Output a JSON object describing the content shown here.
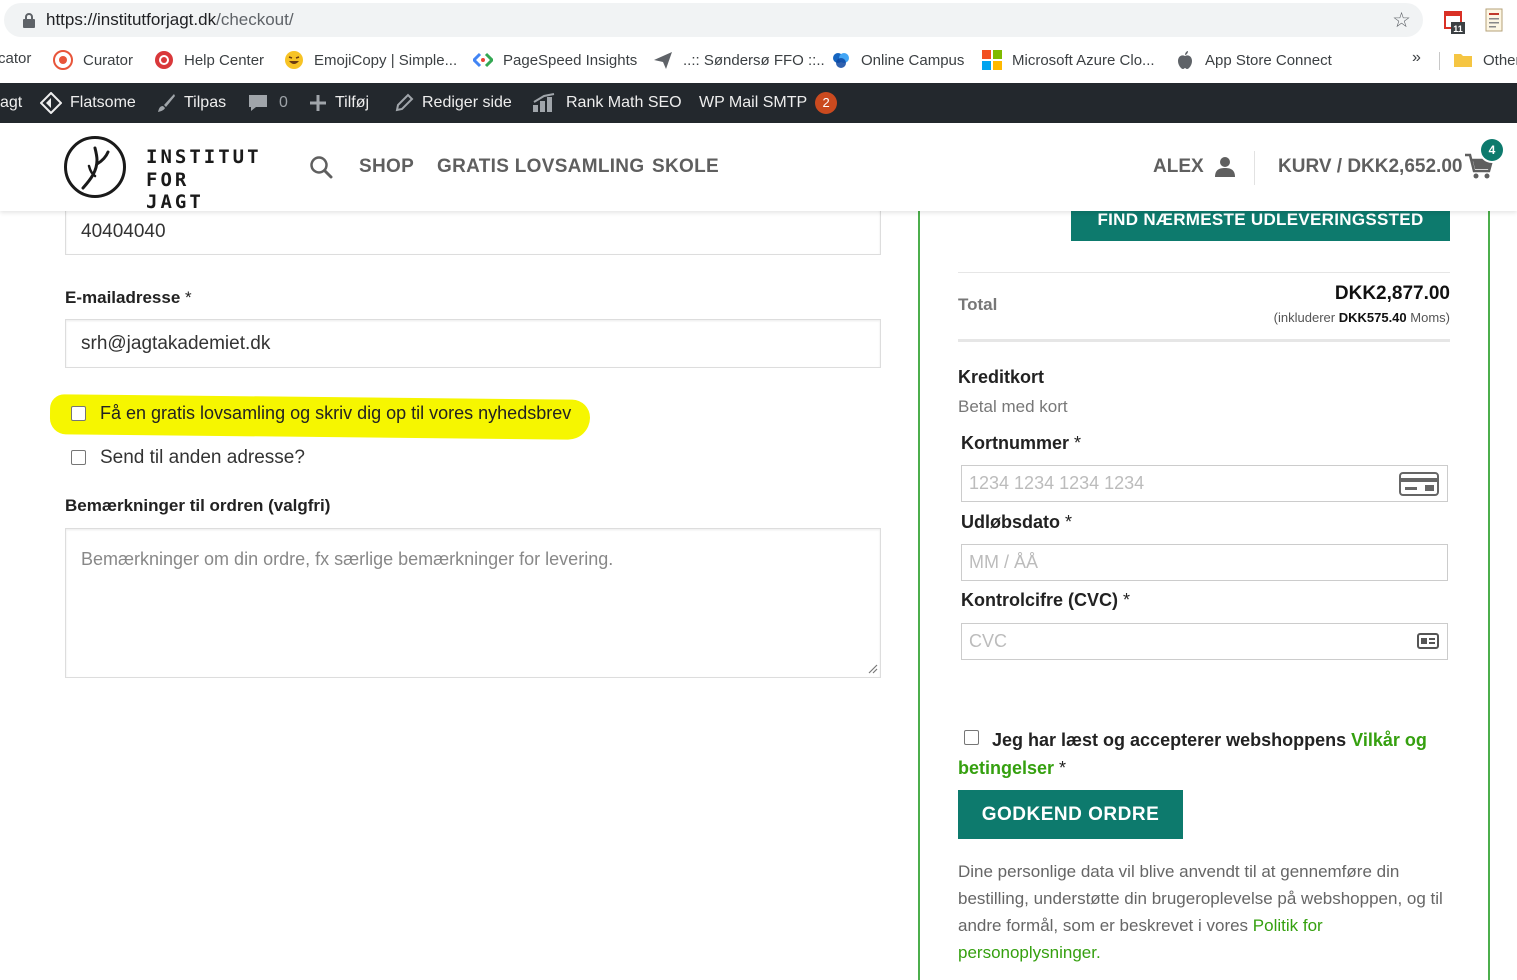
{
  "browser": {
    "url_host": "https://institutforjagt.dk",
    "url_path": "/checkout/",
    "calendar_badge": "11",
    "bookmarks": [
      {
        "label": "cator",
        "icon": "bookmark-icon"
      },
      {
        "label": "Curator",
        "icon": "curator-icon"
      },
      {
        "label": "Help Center",
        "icon": "help-center-icon"
      },
      {
        "label": "EmojiCopy | Simple...",
        "icon": "emoji-icon"
      },
      {
        "label": "PageSpeed Insights",
        "icon": "pagespeed-icon"
      },
      {
        "label": "..:: Søndersø FFO ::..",
        "icon": "paper-plane-icon"
      },
      {
        "label": "Online Campus",
        "icon": "online-campus-icon"
      },
      {
        "label": "Microsoft Azure Clo...",
        "icon": "microsoft-icon"
      },
      {
        "label": "App Store Connect",
        "icon": "apple-icon"
      }
    ],
    "bookmarks_more": "»",
    "other_bookmarks": "Other"
  },
  "adminbar": {
    "site": "agt",
    "flatsome": "Flatsome",
    "customize": "Tilpas",
    "comments_count": "0",
    "new": "Tilføj",
    "edit_page": "Rediger side",
    "rank_math": "Rank Math SEO",
    "wp_mail_smtp": "WP Mail SMTP",
    "smtp_badge": "2"
  },
  "header": {
    "logo_line1": "INSTITUT",
    "logo_line2": "FOR JAGT",
    "nav": [
      "SHOP",
      "GRATIS LOVSAMLING",
      "SKOLE"
    ],
    "account": "ALEX",
    "cart": "KURV / DKK2,652.00",
    "cart_count": "4"
  },
  "form": {
    "phone_value": "40404040",
    "email_label": "E-mailadresse",
    "required_mark": "*",
    "email_value": "srh@jagtakademiet.dk",
    "newsletter_label": "Få en gratis lovsamling og skriv dig op til vores nyhedsbrev",
    "ship_different_label": "Send til anden adresse?",
    "notes_label": "Bemærkninger til ordren (valgfri)",
    "notes_placeholder": "Bemærkninger om din ordre, fx særlige bemærkninger for levering."
  },
  "order": {
    "find_pickup_button": "FIND NÆRMESTE UDLEVERINGSSTED",
    "total_label": "Total",
    "total_value": "DKK2,877.00",
    "tax_prefix": "(inkluderer",
    "tax_amount": "DKK575.40",
    "tax_suffix": "Moms)",
    "payment_method_title": "Kreditkort",
    "payment_method_desc": "Betal med kort",
    "card_number_label": "Kortnummer",
    "card_number_placeholder": "1234 1234 1234 1234",
    "expiry_label": "Udløbsdato",
    "expiry_placeholder": "MM / ÅÅ",
    "cvc_label": "Kontrolcifre (CVC)",
    "cvc_placeholder": "CVC",
    "terms_prefix": "Jeg har læst og accepterer webshoppens",
    "terms_link": "Vilkår og betingelser",
    "place_order_button": "GODKEND ORDRE",
    "privacy_text": "Dine personlige data vil blive anvendt til at gennemføre din bestilling, understøtte din brugeroplevelse på webshoppen, og til andre formål, som er beskrevet i vores",
    "privacy_link": "Politik for personoplysninger."
  },
  "colors": {
    "accent": "#0d7a6d",
    "link_green": "#35a00f",
    "highlight": "#f6f600",
    "adminbar": "#23282d",
    "box_border": "#4cae4c"
  }
}
